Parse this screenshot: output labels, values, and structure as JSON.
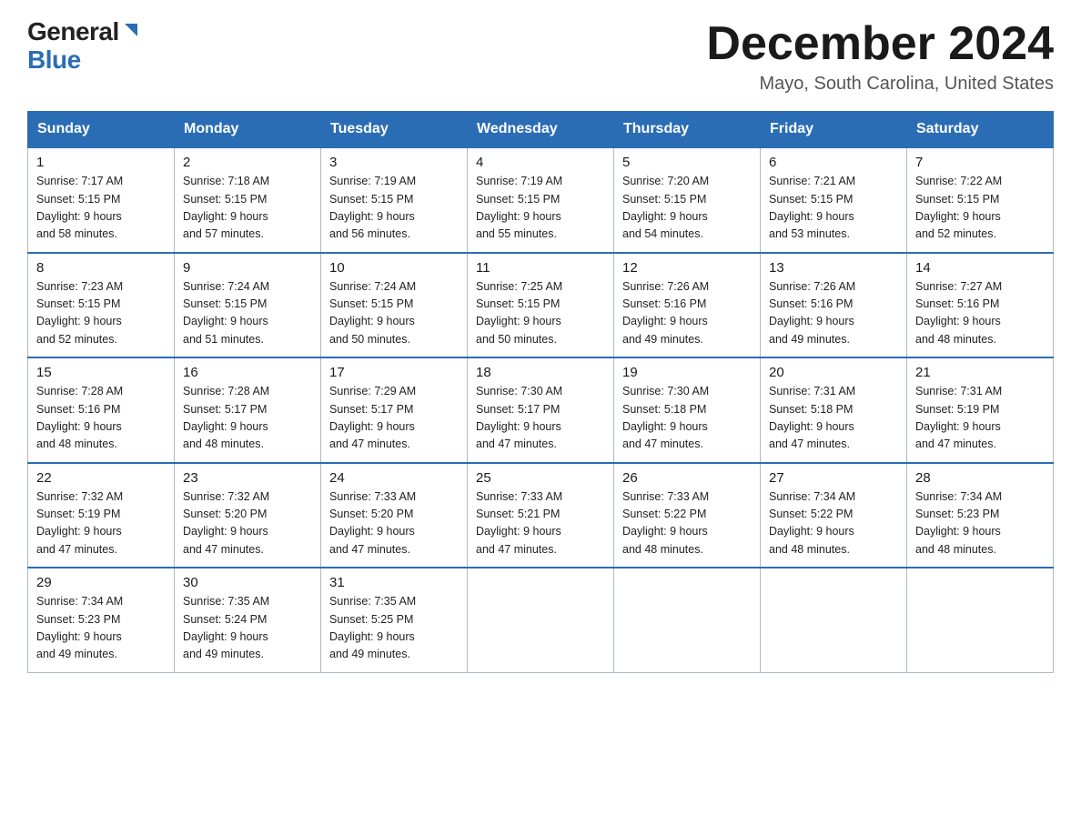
{
  "header": {
    "month_title": "December 2024",
    "location": "Mayo, South Carolina, United States",
    "logo_general": "General",
    "logo_blue": "Blue"
  },
  "weekdays": [
    "Sunday",
    "Monday",
    "Tuesday",
    "Wednesday",
    "Thursday",
    "Friday",
    "Saturday"
  ],
  "weeks": [
    [
      {
        "day": "1",
        "sunrise": "7:17 AM",
        "sunset": "5:15 PM",
        "daylight": "9 hours and 58 minutes."
      },
      {
        "day": "2",
        "sunrise": "7:18 AM",
        "sunset": "5:15 PM",
        "daylight": "9 hours and 57 minutes."
      },
      {
        "day": "3",
        "sunrise": "7:19 AM",
        "sunset": "5:15 PM",
        "daylight": "9 hours and 56 minutes."
      },
      {
        "day": "4",
        "sunrise": "7:19 AM",
        "sunset": "5:15 PM",
        "daylight": "9 hours and 55 minutes."
      },
      {
        "day": "5",
        "sunrise": "7:20 AM",
        "sunset": "5:15 PM",
        "daylight": "9 hours and 54 minutes."
      },
      {
        "day": "6",
        "sunrise": "7:21 AM",
        "sunset": "5:15 PM",
        "daylight": "9 hours and 53 minutes."
      },
      {
        "day": "7",
        "sunrise": "7:22 AM",
        "sunset": "5:15 PM",
        "daylight": "9 hours and 52 minutes."
      }
    ],
    [
      {
        "day": "8",
        "sunrise": "7:23 AM",
        "sunset": "5:15 PM",
        "daylight": "9 hours and 52 minutes."
      },
      {
        "day": "9",
        "sunrise": "7:24 AM",
        "sunset": "5:15 PM",
        "daylight": "9 hours and 51 minutes."
      },
      {
        "day": "10",
        "sunrise": "7:24 AM",
        "sunset": "5:15 PM",
        "daylight": "9 hours and 50 minutes."
      },
      {
        "day": "11",
        "sunrise": "7:25 AM",
        "sunset": "5:15 PM",
        "daylight": "9 hours and 50 minutes."
      },
      {
        "day": "12",
        "sunrise": "7:26 AM",
        "sunset": "5:16 PM",
        "daylight": "9 hours and 49 minutes."
      },
      {
        "day": "13",
        "sunrise": "7:26 AM",
        "sunset": "5:16 PM",
        "daylight": "9 hours and 49 minutes."
      },
      {
        "day": "14",
        "sunrise": "7:27 AM",
        "sunset": "5:16 PM",
        "daylight": "9 hours and 48 minutes."
      }
    ],
    [
      {
        "day": "15",
        "sunrise": "7:28 AM",
        "sunset": "5:16 PM",
        "daylight": "9 hours and 48 minutes."
      },
      {
        "day": "16",
        "sunrise": "7:28 AM",
        "sunset": "5:17 PM",
        "daylight": "9 hours and 48 minutes."
      },
      {
        "day": "17",
        "sunrise": "7:29 AM",
        "sunset": "5:17 PM",
        "daylight": "9 hours and 47 minutes."
      },
      {
        "day": "18",
        "sunrise": "7:30 AM",
        "sunset": "5:17 PM",
        "daylight": "9 hours and 47 minutes."
      },
      {
        "day": "19",
        "sunrise": "7:30 AM",
        "sunset": "5:18 PM",
        "daylight": "9 hours and 47 minutes."
      },
      {
        "day": "20",
        "sunrise": "7:31 AM",
        "sunset": "5:18 PM",
        "daylight": "9 hours and 47 minutes."
      },
      {
        "day": "21",
        "sunrise": "7:31 AM",
        "sunset": "5:19 PM",
        "daylight": "9 hours and 47 minutes."
      }
    ],
    [
      {
        "day": "22",
        "sunrise": "7:32 AM",
        "sunset": "5:19 PM",
        "daylight": "9 hours and 47 minutes."
      },
      {
        "day": "23",
        "sunrise": "7:32 AM",
        "sunset": "5:20 PM",
        "daylight": "9 hours and 47 minutes."
      },
      {
        "day": "24",
        "sunrise": "7:33 AM",
        "sunset": "5:20 PM",
        "daylight": "9 hours and 47 minutes."
      },
      {
        "day": "25",
        "sunrise": "7:33 AM",
        "sunset": "5:21 PM",
        "daylight": "9 hours and 47 minutes."
      },
      {
        "day": "26",
        "sunrise": "7:33 AM",
        "sunset": "5:22 PM",
        "daylight": "9 hours and 48 minutes."
      },
      {
        "day": "27",
        "sunrise": "7:34 AM",
        "sunset": "5:22 PM",
        "daylight": "9 hours and 48 minutes."
      },
      {
        "day": "28",
        "sunrise": "7:34 AM",
        "sunset": "5:23 PM",
        "daylight": "9 hours and 48 minutes."
      }
    ],
    [
      {
        "day": "29",
        "sunrise": "7:34 AM",
        "sunset": "5:23 PM",
        "daylight": "9 hours and 49 minutes."
      },
      {
        "day": "30",
        "sunrise": "7:35 AM",
        "sunset": "5:24 PM",
        "daylight": "9 hours and 49 minutes."
      },
      {
        "day": "31",
        "sunrise": "7:35 AM",
        "sunset": "5:25 PM",
        "daylight": "9 hours and 49 minutes."
      },
      null,
      null,
      null,
      null
    ]
  ],
  "labels": {
    "sunrise": "Sunrise:",
    "sunset": "Sunset:",
    "daylight": "Daylight:"
  }
}
